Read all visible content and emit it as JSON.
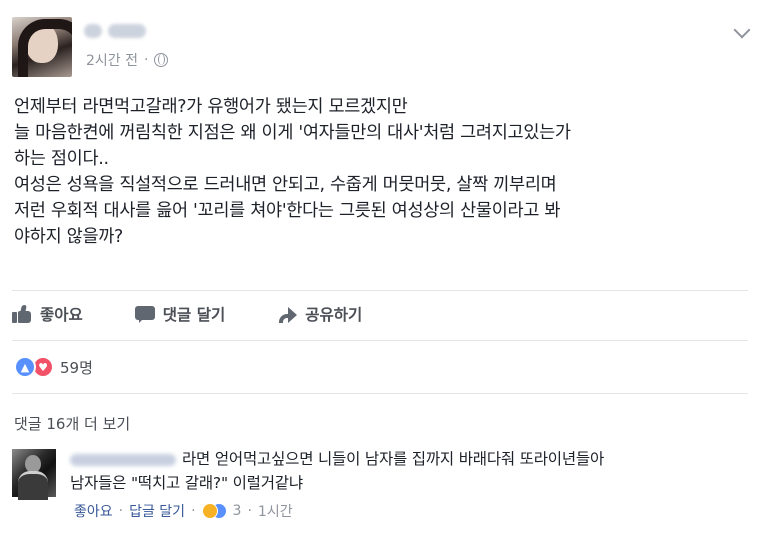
{
  "post": {
    "time": "2시간 전",
    "dot": "·",
    "lines": [
      "언제부터 라면먹고갈래?가 유행어가 됐는지 모르겠지만",
      "늘 마음한켠에 꺼림칙한 지점은 왜 이게 '여자들만의 대사'처럼 그려지고있는가",
      "하는 점이다..",
      "여성은 성욕을 직설적으로 드러내면 안되고, 수줍게 머뭇머뭇, 살짝 끼부리며",
      "저런 우회적 대사를 읊어 '꼬리를 쳐야'한다는 그릇된 여성상의 산물이라고 봐",
      "야하지 않을까?"
    ]
  },
  "actions": {
    "like": "좋아요",
    "comment": "댓글 달기",
    "share": "공유하기"
  },
  "reactions": {
    "count": "59명"
  },
  "comments": {
    "more_label": "댓글 16개 더 보기",
    "items": [
      {
        "line1": "라면 얻어먹고싶으면 니들이 남자를 집까지 바래다줘 또라이년들아",
        "line2": "남자들은 \"떡치고 갈래?\" 이럴거같냐",
        "like": "좋아요",
        "sep1": "·",
        "reply": "답글 달기",
        "sep2": "·",
        "reaction_count": "3",
        "sep3": "·",
        "time": "1시간"
      }
    ]
  },
  "icons": {
    "globe": "globe-icon",
    "chevron": "chevron-down-icon",
    "like": "thumbs-up-icon",
    "comment": "comment-bubble-icon",
    "share": "share-arrow-icon"
  },
  "colors": {
    "text": "#1d2129",
    "muted": "#90949c",
    "action": "#4b4f56",
    "link": "#385898",
    "like_blue": "#5890ff",
    "love_red": "#f25268",
    "haha_yellow": "#f7b125"
  }
}
